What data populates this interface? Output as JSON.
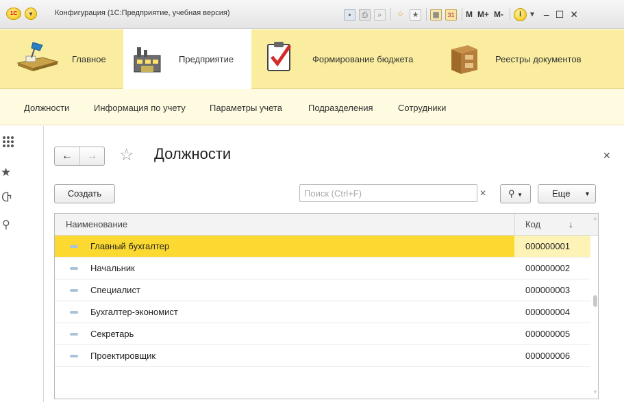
{
  "window": {
    "title": "Конфигурация  (1С:Предприятие, учебная версия)",
    "logo": "1С",
    "memory_buttons": [
      "M",
      "M+",
      "M-"
    ]
  },
  "sections": [
    {
      "label": "Главное",
      "icon": "desk-lamp-icon",
      "active": false
    },
    {
      "label": "Предприятие",
      "icon": "factory-icon",
      "active": true
    },
    {
      "label": "Формирование бюджета",
      "icon": "checklist-clipboard-icon",
      "active": false
    },
    {
      "label": "Реестры документов",
      "icon": "file-cabinet-icon",
      "active": false
    }
  ],
  "navigation": [
    "Должности",
    "Информация по учету",
    "Параметры учета",
    "Подразделения",
    "Сотрудники"
  ],
  "form": {
    "title": "Должности",
    "create_label": "Создать",
    "search_placeholder": "Поиск (Ctrl+F)",
    "more_label": "Еще",
    "columns": {
      "name": "Наименование",
      "code": "Код"
    },
    "rows": [
      {
        "name": "Главный бухгалтер",
        "code": "000000001",
        "selected": true
      },
      {
        "name": "Начальник",
        "code": "000000002",
        "selected": false
      },
      {
        "name": "Специалист",
        "code": "000000003",
        "selected": false
      },
      {
        "name": "Бухгалтер-экономист",
        "code": "000000004",
        "selected": false
      },
      {
        "name": "Секретарь",
        "code": "000000005",
        "selected": false
      },
      {
        "name": "Проектировщик",
        "code": "000000006",
        "selected": false
      }
    ]
  },
  "colors": {
    "sections_bg": "#faeda0",
    "nav_bg": "#fffbe0",
    "selected_row": "#fcd930"
  }
}
